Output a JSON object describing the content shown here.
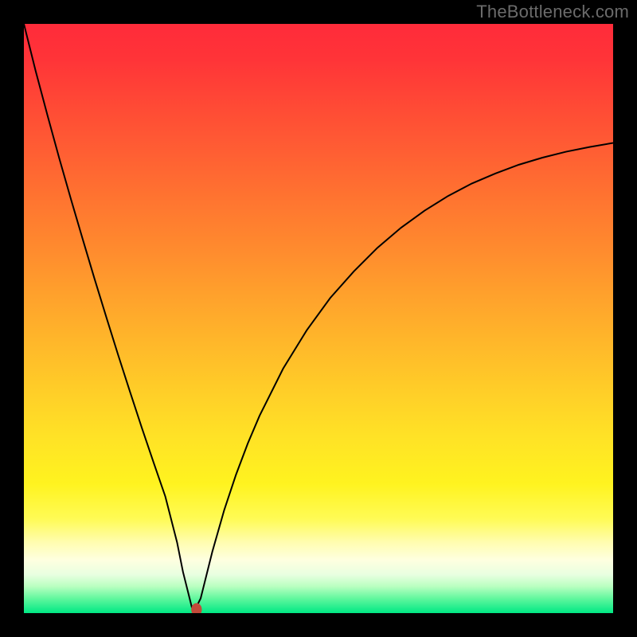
{
  "watermark": "TheBottleneck.com",
  "chart_data": {
    "type": "line",
    "title": "",
    "xlabel": "",
    "ylabel": "",
    "xlim": [
      0,
      100
    ],
    "ylim": [
      0,
      100
    ],
    "background_gradient": {
      "stops": [
        {
          "offset": 0.0,
          "color": "#ff2b3a"
        },
        {
          "offset": 0.06,
          "color": "#ff3438"
        },
        {
          "offset": 0.14,
          "color": "#ff4a35"
        },
        {
          "offset": 0.22,
          "color": "#ff5f33"
        },
        {
          "offset": 0.3,
          "color": "#ff7530"
        },
        {
          "offset": 0.38,
          "color": "#ff8a2e"
        },
        {
          "offset": 0.46,
          "color": "#ffa12c"
        },
        {
          "offset": 0.54,
          "color": "#ffb72a"
        },
        {
          "offset": 0.62,
          "color": "#ffcd28"
        },
        {
          "offset": 0.7,
          "color": "#ffe226"
        },
        {
          "offset": 0.78,
          "color": "#fff31f"
        },
        {
          "offset": 0.84,
          "color": "#fffb55"
        },
        {
          "offset": 0.88,
          "color": "#fffdb0"
        },
        {
          "offset": 0.91,
          "color": "#feffe0"
        },
        {
          "offset": 0.935,
          "color": "#e8ffe0"
        },
        {
          "offset": 0.955,
          "color": "#b8ffc0"
        },
        {
          "offset": 0.975,
          "color": "#62f79e"
        },
        {
          "offset": 1.0,
          "color": "#00e884"
        }
      ]
    },
    "series": [
      {
        "name": "bottleneck-curve",
        "color": "#000000",
        "width": 2,
        "x": [
          0,
          2,
          4,
          6,
          8,
          10,
          12,
          14,
          16,
          18,
          20,
          22,
          24,
          26,
          27,
          28,
          28.5,
          29,
          30,
          31,
          32,
          34,
          36,
          38,
          40,
          44,
          48,
          52,
          56,
          60,
          64,
          68,
          72,
          76,
          80,
          84,
          88,
          92,
          96,
          100
        ],
        "values": [
          100,
          92.0,
          84.5,
          77.2,
          70.2,
          63.4,
          56.7,
          50.2,
          43.8,
          37.6,
          31.5,
          25.6,
          19.8,
          12.0,
          7.0,
          3.0,
          1.0,
          0.5,
          2.5,
          6.5,
          10.5,
          17.5,
          23.5,
          28.8,
          33.5,
          41.5,
          48.0,
          53.5,
          58.0,
          62.0,
          65.4,
          68.3,
          70.8,
          72.9,
          74.6,
          76.1,
          77.3,
          78.3,
          79.1,
          79.8
        ]
      }
    ],
    "marker": {
      "x": 29.3,
      "y": 0.6,
      "rx": 0.9,
      "ry": 1.1,
      "color": "#c24a3a"
    }
  }
}
